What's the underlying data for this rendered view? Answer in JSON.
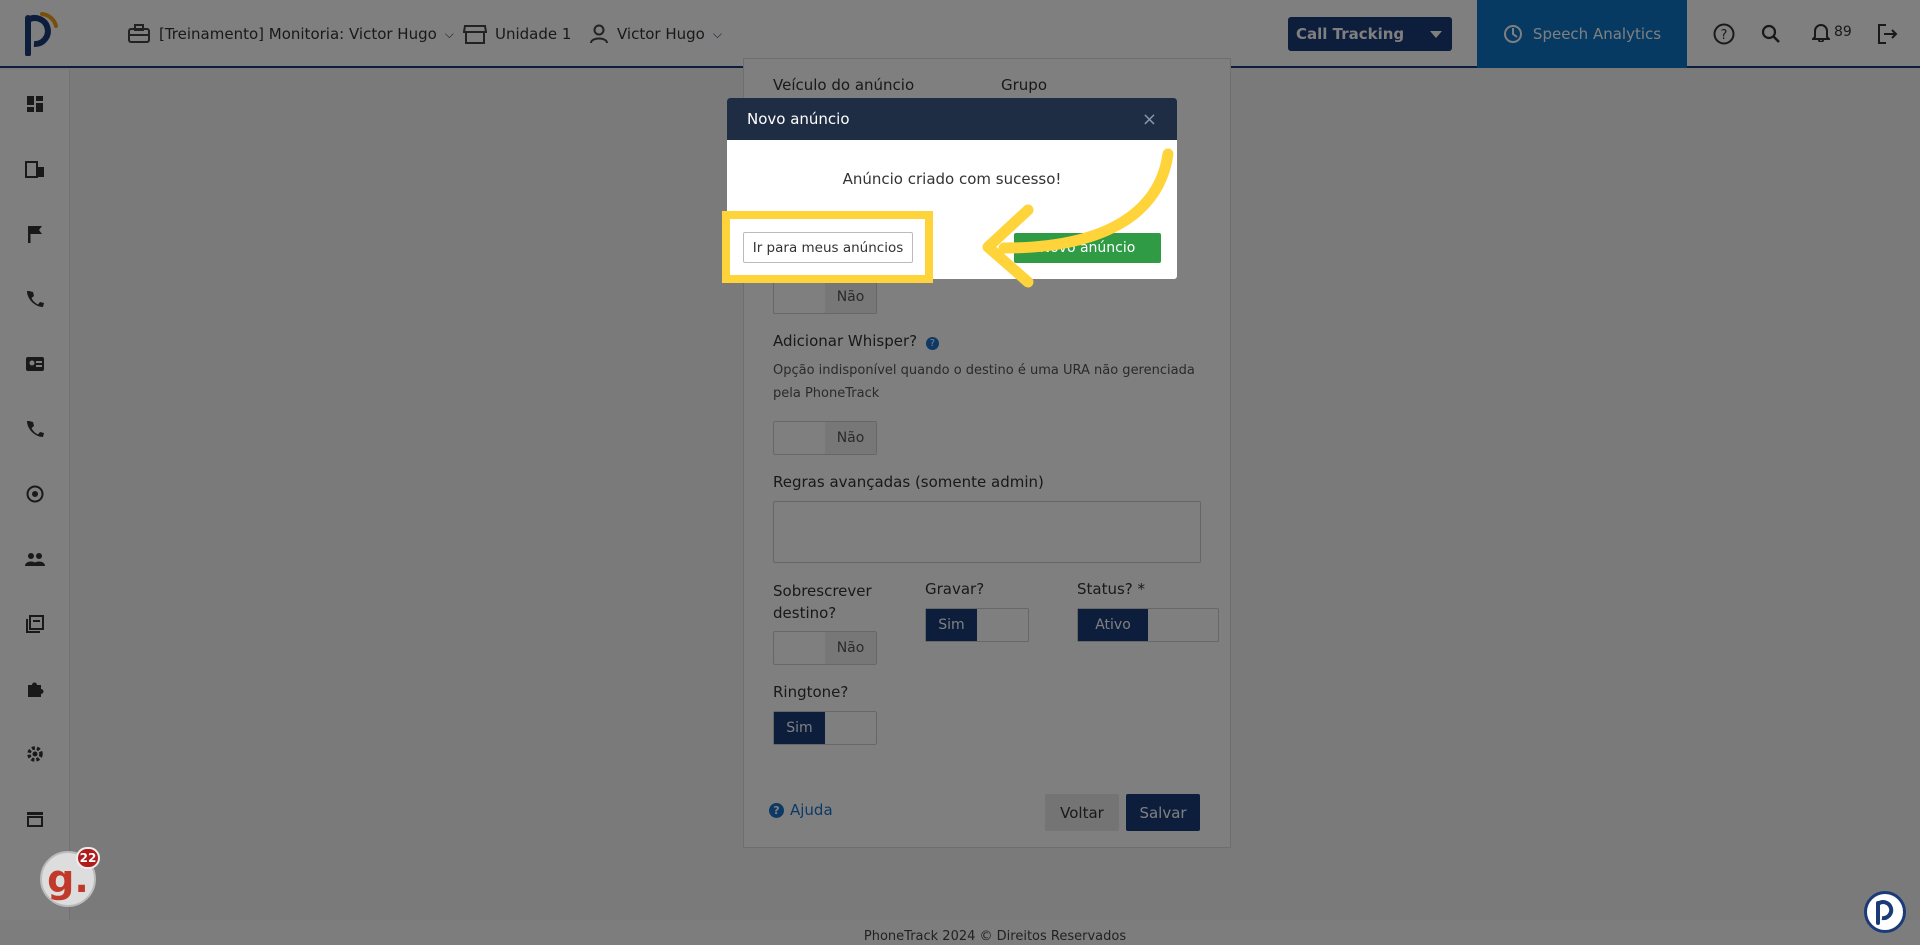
{
  "header": {
    "company": "[Treinamento] Monitoria: Victor Hugo",
    "unit": "Unidade 1",
    "user": "Victor Hugo",
    "product_select": "Call Tracking",
    "speech_analytics": "Speech Analytics",
    "notifications_count": "89"
  },
  "form": {
    "veiculo_label": "Veículo do anúncio",
    "grupo_label": "Grupo",
    "toggle_nao_1": "Não",
    "whisper_label": "Adicionar Whisper?",
    "whisper_desc": "Opção indisponível quando o destino é uma URA não gerenciada pela PhoneTrack",
    "toggle_nao_2": "Não",
    "regras_label": "Regras avançadas (somente admin)",
    "sobrescrever_label": "Sobrescrever destino?",
    "toggle_nao_3": "Não",
    "gravar_label": "Gravar?",
    "gravar_value": "Sim",
    "status_label": "Status? *",
    "status_value": "Ativo",
    "ringtone_label": "Ringtone?",
    "ringtone_value": "Sim",
    "help_link": "Ajuda",
    "back_button": "Voltar",
    "save_button": "Salvar"
  },
  "modal": {
    "title": "Novo anúncio",
    "close": "×",
    "message": "Anúncio criado com sucesso!",
    "go_to_ads_button": "Ir para meus anúncios",
    "new_ad_button": "Novo anúncio"
  },
  "footer": {
    "text": "PhoneTrack 2024 © Direitos Reservados"
  },
  "chat_widget": {
    "letter": "g.",
    "badge": "22"
  },
  "colors": {
    "primary": "#1b3b78",
    "speech": "#0d74c7",
    "success": "#2f9b45",
    "highlight": "#ffd43b"
  }
}
